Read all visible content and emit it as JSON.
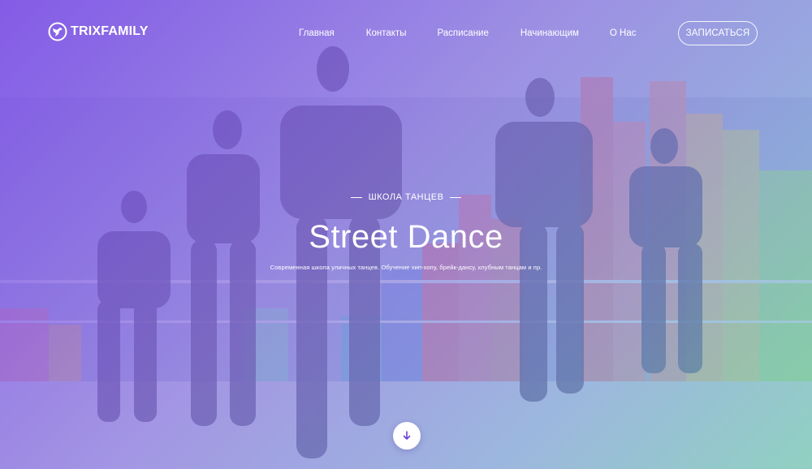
{
  "brand": {
    "logo_text": "TRIXFAMILY",
    "logo_icon": "dancer-circle-icon"
  },
  "nav": {
    "items": [
      {
        "label": "Главная"
      },
      {
        "label": "Контакты"
      },
      {
        "label": "Расписание"
      },
      {
        "label": "Начинающим"
      },
      {
        "label": "О Нас"
      }
    ],
    "cta_label": "ЗАПИСАТЬСЯ"
  },
  "hero": {
    "eyebrow": "ШКОЛА ТАНЦЕВ",
    "title": "Street Dance",
    "subtitle": "Современная школа уличных танцев. Обучение хип-хопу, брейк-дансу, клубным танцам и пр.",
    "scroll_icon": "arrow-down-icon"
  },
  "colors": {
    "overlay_start": "#7846e6",
    "overlay_end": "#6ed7aa",
    "scroll_icon": "#6a3fd6"
  }
}
